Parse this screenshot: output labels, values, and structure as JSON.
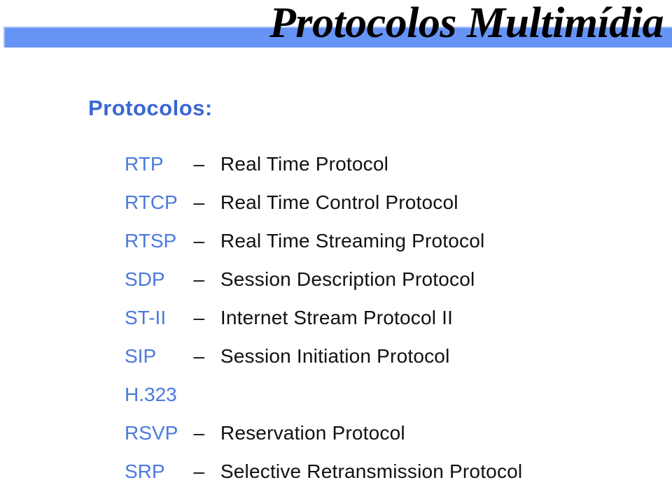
{
  "slide": {
    "title": "Protocolos Multimídia",
    "heading": "Protocolos:",
    "colors": {
      "band_blue": "#6694f5",
      "band_highlight": "#a9c3f7",
      "heading_blue": "#3b66d6",
      "acronym_blue": "#4a7ae0",
      "text_black": "#111111",
      "background": "#ffffff"
    },
    "dash": "–",
    "protocols": [
      {
        "acronym": "RTP",
        "dash": "–",
        "description": "Real Time Protocol"
      },
      {
        "acronym": "RTCP",
        "dash": "–",
        "description": "Real Time Control Protocol"
      },
      {
        "acronym": "RTSP",
        "dash": "–",
        "description": "Real Time Streaming Protocol"
      },
      {
        "acronym": "SDP",
        "dash": "–",
        "description": "Session Description Protocol"
      },
      {
        "acronym": "ST-II",
        "dash": "–",
        "description": "Internet Stream Protocol II"
      },
      {
        "acronym": "SIP",
        "dash": "–",
        "description": "Session Initiation Protocol"
      },
      {
        "acronym": "H.323",
        "dash": "",
        "description": ""
      },
      {
        "acronym": "RSVP",
        "dash": "–",
        "description": "Reservation Protocol"
      },
      {
        "acronym": "SRP",
        "dash": "–",
        "description": "Selective Retransmission Protocol"
      }
    ]
  }
}
